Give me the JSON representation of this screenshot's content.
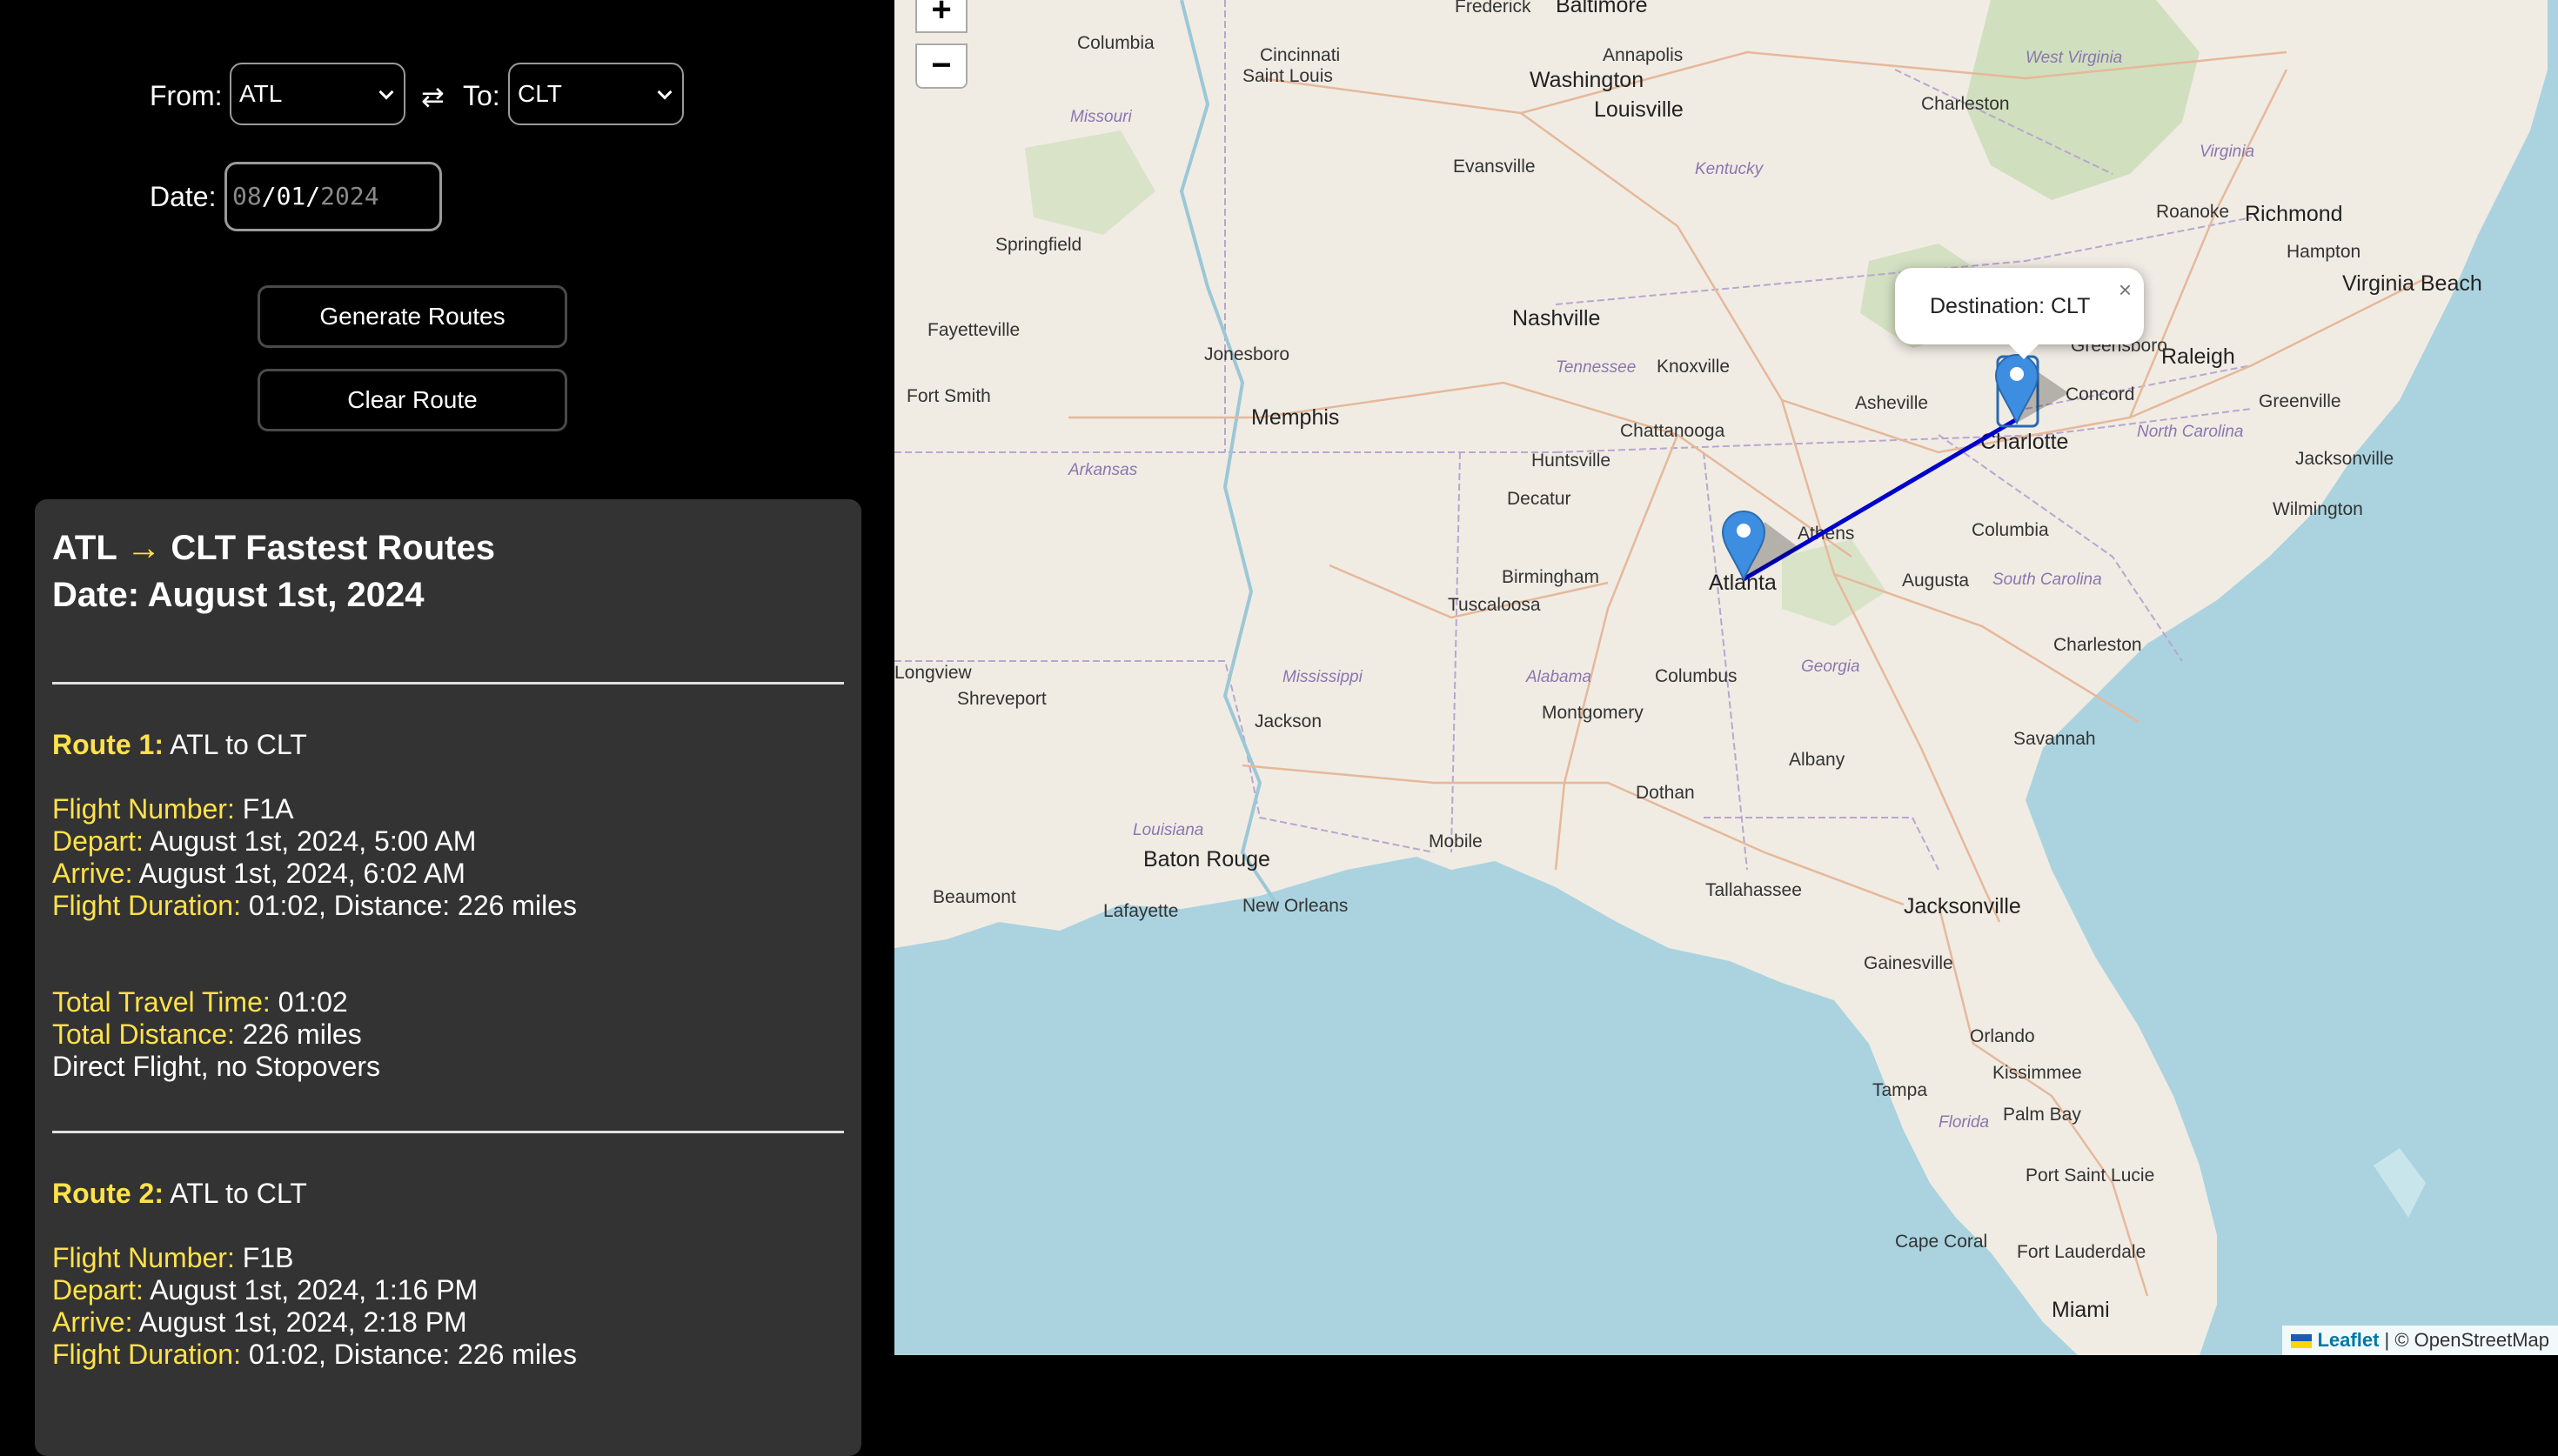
{
  "form": {
    "from_label": "From:",
    "from_value": "ATL",
    "swap_icon": "⇄",
    "to_label": "To:",
    "to_value": "CLT",
    "date_label": "Date:",
    "date_month": "08",
    "date_sep1": "/",
    "date_day": "01",
    "date_sep2": "/",
    "date_year": "2024",
    "generate_label": "Generate Routes",
    "clear_label": "Clear Route"
  },
  "results": {
    "title_from": "ATL",
    "title_arrow": "→",
    "title_rest": "CLT Fastest Routes",
    "date_line": "Date: August 1st, 2024",
    "routes": [
      {
        "route_label": "Route 1:",
        "route_value": "ATL to CLT",
        "flight_label": "Flight Number:",
        "flight_value": "F1A",
        "depart_label": "Depart:",
        "depart_value": "August 1st, 2024, 5:00 AM",
        "arrive_label": "Arrive:",
        "arrive_value": "August 1st, 2024, 6:02 AM",
        "duration_label": "Flight Duration:",
        "duration_value": "01:02, Distance: 226 miles",
        "total_time_label": "Total Travel Time:",
        "total_time_value": "01:02",
        "total_distance_label": "Total Distance:",
        "total_distance_value": "226 miles",
        "note": "Direct Flight, no Stopovers"
      },
      {
        "route_label": "Route 2:",
        "route_value": "ATL to CLT",
        "flight_label": "Flight Number:",
        "flight_value": "F1B",
        "depart_label": "Depart:",
        "depart_value": "August 1st, 2024, 1:16 PM",
        "arrive_label": "Arrive:",
        "arrive_value": "August 1st, 2024, 2:18 PM",
        "duration_label": "Flight Duration:",
        "duration_value": "01:02, Distance: 226 miles"
      }
    ]
  },
  "map": {
    "zoom_in": "+",
    "zoom_out": "−",
    "popup_text": "Destination: CLT",
    "popup_close": "×",
    "attribution_leaflet": "Leaflet",
    "attribution_sep": " | ",
    "attribution_osm": "© OpenStreetMap",
    "route_color": "#0000cc",
    "marker_color": "#3d8ee0",
    "cities": [
      "Frederick",
      "Baltimore",
      "Annapolis",
      "Washington",
      "Columbia",
      "Cincinnati",
      "Saint Louis",
      "Louisville",
      "Charleston",
      "West Virginia",
      "Evansville",
      "Kentucky",
      "Virginia",
      "Roanoke",
      "Richmond",
      "Hampton",
      "Virginia Beach",
      "Springfield",
      "Missouri",
      "Nashville",
      "Fayetteville",
      "Jonesboro",
      "Tennessee",
      "Knoxville",
      "Raleigh",
      "Greensboro",
      "Concord",
      "Greenville",
      "Fort Smith",
      "Memphis",
      "Asheville",
      "Chattanooga",
      "Charlotte",
      "North Carolina",
      "Jacksonville",
      "Arkansas",
      "Huntsville",
      "Decatur",
      "Wilmington",
      "Columbia",
      "Athens",
      "Birmingham",
      "Atlanta",
      "Augusta",
      "South Carolina",
      "Tuscaloosa",
      "Charleston",
      "Longview",
      "Shreveport",
      "Mississippi",
      "Alabama",
      "Georgia",
      "Jackson",
      "Montgomery",
      "Columbus",
      "Savannah",
      "Albany",
      "Dothan",
      "Louisiana",
      "Mobile",
      "Baton Rouge",
      "Tallahassee",
      "Beaumont",
      "Lafayette",
      "New Orleans",
      "Jacksonville",
      "Gainesville",
      "Orlando",
      "Kissimmee",
      "Tampa",
      "Florida",
      "Palm Bay",
      "Port Saint Lucie",
      "Cape Coral",
      "Fort Lauderdale",
      "Miami"
    ]
  }
}
